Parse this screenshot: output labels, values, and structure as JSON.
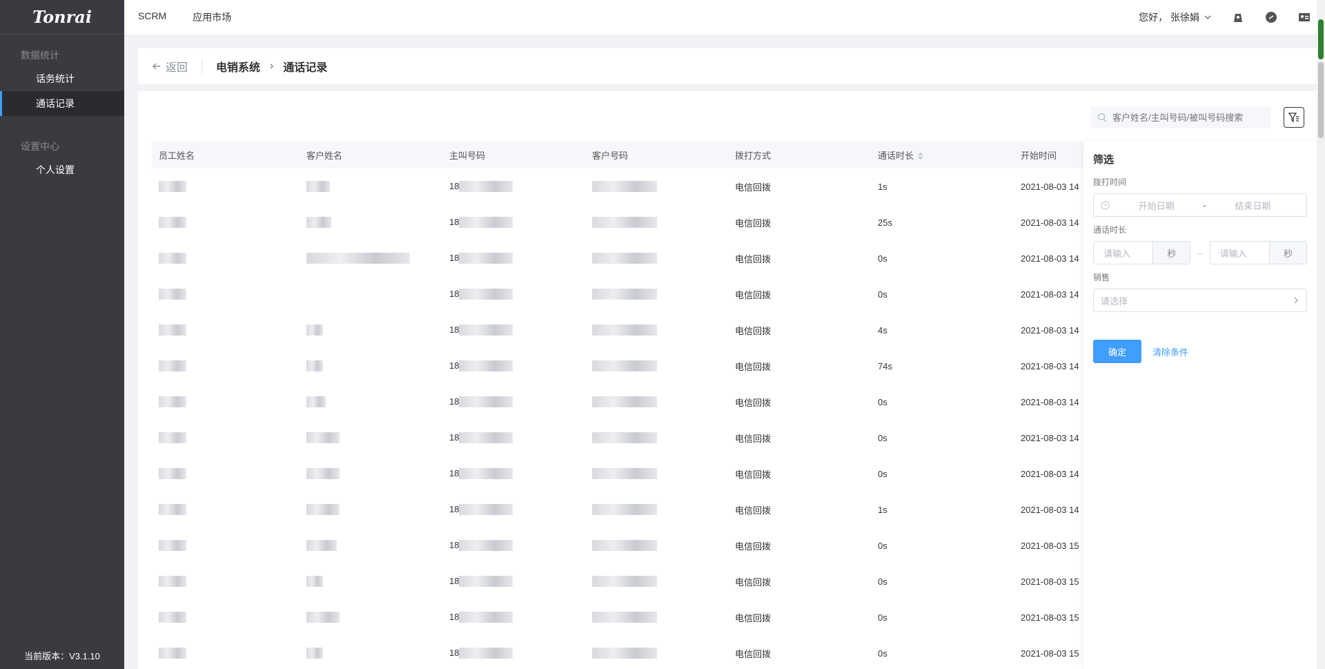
{
  "sidebar": {
    "logo": "Tonrai",
    "groups": [
      {
        "title": "数据统计",
        "items": [
          {
            "label": "话务统计"
          },
          {
            "label": "通话记录"
          }
        ]
      },
      {
        "title": "设置中心",
        "items": [
          {
            "label": "个人设置"
          }
        ]
      }
    ],
    "version": "当前版本：V3.1.10"
  },
  "topbar": {
    "nav": [
      "SCRM",
      "应用市场"
    ],
    "greeting": "您好， 张徐娟"
  },
  "breadcrumb": {
    "back": "返回",
    "items": [
      "电销系统",
      "通话记录"
    ]
  },
  "search": {
    "placeholder": "客户姓名/主叫号码/被叫号码搜索"
  },
  "table": {
    "headers": [
      "员工姓名",
      "客户姓名",
      "主叫号码",
      "客户号码",
      "拨打方式",
      "通话时长",
      "开始时间"
    ],
    "rows": [
      {
        "caller_prefix": "18",
        "method": "电信回拨",
        "duration": "1s",
        "start": "2021-08-03 14"
      },
      {
        "caller_prefix": "18",
        "method": "电信回拨",
        "duration": "25s",
        "start": "2021-08-03 14"
      },
      {
        "caller_prefix": "18",
        "method": "电信回拨",
        "duration": "0s",
        "start": "2021-08-03 14"
      },
      {
        "caller_prefix": "18",
        "method": "电信回拨",
        "duration": "0s",
        "start": "2021-08-03 14"
      },
      {
        "caller_prefix": "18",
        "method": "电信回拨",
        "duration": "4s",
        "start": "2021-08-03 14"
      },
      {
        "caller_prefix": "18",
        "method": "电信回拨",
        "duration": "74s",
        "start": "2021-08-03 14"
      },
      {
        "caller_prefix": "18",
        "method": "电信回拨",
        "duration": "0s",
        "start": "2021-08-03 14"
      },
      {
        "caller_prefix": "18",
        "method": "电信回拨",
        "duration": "0s",
        "start": "2021-08-03 14"
      },
      {
        "caller_prefix": "18",
        "method": "电信回拨",
        "duration": "0s",
        "start": "2021-08-03 14"
      },
      {
        "caller_prefix": "18",
        "method": "电信回拨",
        "duration": "1s",
        "start": "2021-08-03 14"
      },
      {
        "caller_prefix": "18",
        "method": "电信回拨",
        "duration": "0s",
        "start": "2021-08-03 15"
      },
      {
        "caller_prefix": "18",
        "method": "电信回拨",
        "duration": "0s",
        "start": "2021-08-03 15"
      },
      {
        "caller_prefix": "18",
        "method": "电信回拨",
        "duration": "0s",
        "start": "2021-08-03 15"
      },
      {
        "caller_prefix": "18",
        "method": "电信回拨",
        "duration": "0s",
        "start": "2021-08-03 15"
      }
    ]
  },
  "filter": {
    "title": "筛选",
    "call_time_label": "拨打时间",
    "start_date": "开始日期",
    "date_sep": "-",
    "end_date": "结束日期",
    "duration_label": "通话时长",
    "duration_placeholder": "请输入",
    "duration_unit": "秒",
    "sales_label": "销售",
    "sales_placeholder": "请选择",
    "confirm": "确定",
    "clear": "清除条件"
  },
  "colors": {
    "accent": "#409eff",
    "sidebar": "#3a3b40"
  }
}
